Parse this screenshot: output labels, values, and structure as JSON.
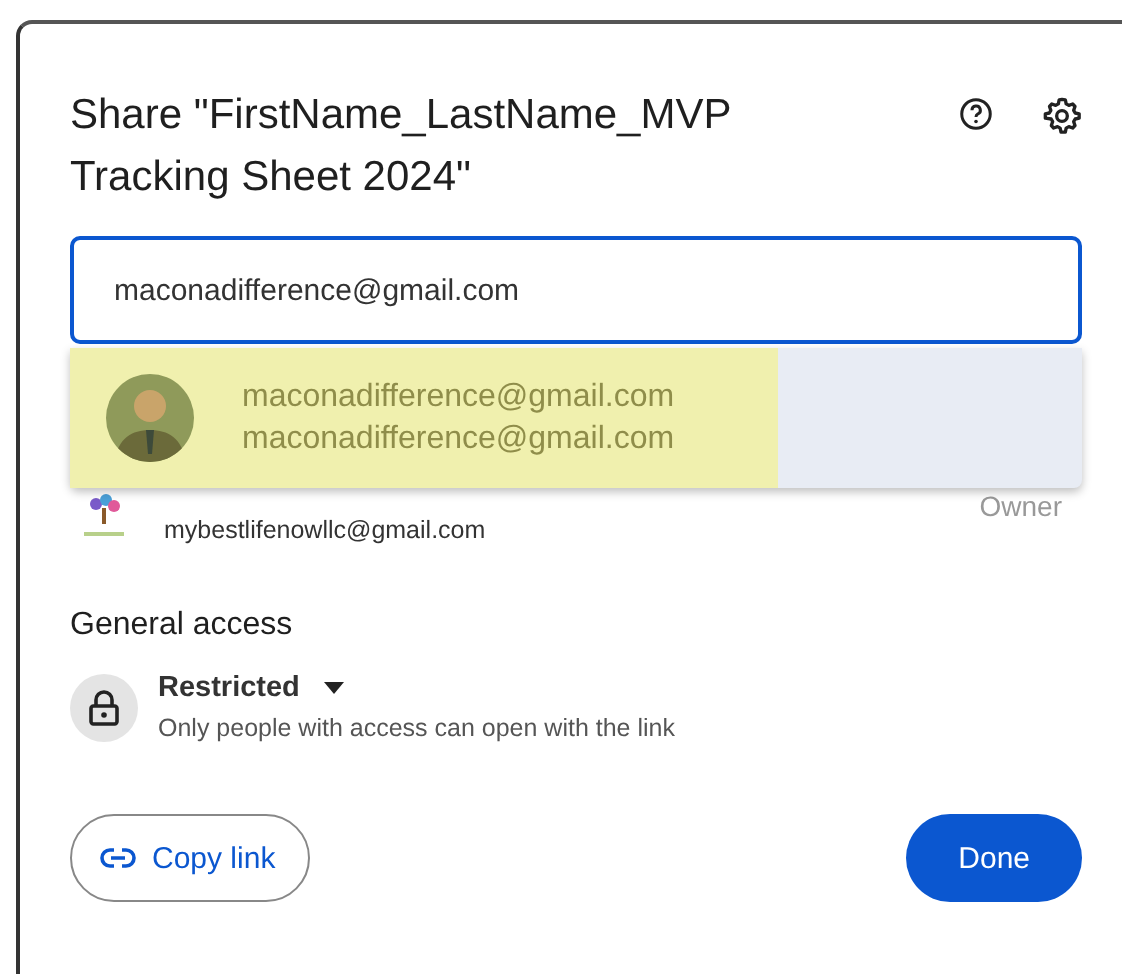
{
  "dialog": {
    "title": "Share \"FirstName_LastName_MVP Tracking Sheet 2024\""
  },
  "recipient_field": {
    "value": "maconadifference@gmail.com"
  },
  "suggestions": [
    {
      "name": "maconadifference@gmail.com",
      "email": "maconadifference@gmail.com",
      "highlighted": true
    }
  ],
  "members": [
    {
      "email": "mybestlifenowllc@gmail.com",
      "role": "Owner"
    }
  ],
  "general_access": {
    "heading": "General access",
    "setting": "Restricted",
    "description": "Only people with access can open with the link"
  },
  "buttons": [
    {
      "kind": "outline",
      "label": "Copy link"
    },
    {
      "kind": "filled",
      "label": "Done"
    }
  ]
}
